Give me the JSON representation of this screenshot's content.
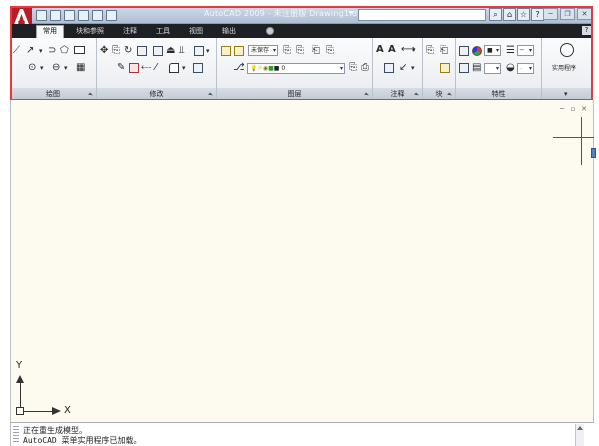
{
  "window": {
    "title": "AutoCAD 2009 - 未注册版 Drawing1.dwg",
    "quick_access_icons": [
      "new-icon",
      "open-icon",
      "save-icon",
      "plot-icon",
      "undo-icon",
      "redo-icon"
    ],
    "help_icons": [
      "search-icon",
      "infocenter-icon",
      "favorites-icon",
      "help-icon"
    ],
    "window_buttons": [
      "minimize",
      "restore",
      "close"
    ]
  },
  "tabs": [
    {
      "label": "常用",
      "active": true
    },
    {
      "label": "块和参照"
    },
    {
      "label": "注释"
    },
    {
      "label": "工具"
    },
    {
      "label": "视图"
    },
    {
      "label": "输出"
    }
  ],
  "ribbon": {
    "panels": [
      {
        "title": "绘图"
      },
      {
        "title": "修改"
      },
      {
        "title": "图层"
      },
      {
        "title": "注释"
      },
      {
        "title": "块"
      },
      {
        "title": "特性"
      },
      {
        "title": ""
      }
    ],
    "layer_state": "未保存",
    "layer_current": "0",
    "utilities_label": "实用程序"
  },
  "drawing": {
    "viewport_controls": [
      "─",
      "▫",
      "✕"
    ],
    "ucs_x": "X",
    "ucs_y": "Y"
  },
  "command_line": {
    "line1": "正在重生成模型。",
    "line2": "AutoCAD 菜单实用程序已加载。"
  },
  "colors": {
    "title_bar": "#aebfd4",
    "tab_bar": "#1f2023",
    "canvas": "#fdfbef",
    "highlight": "#e23a3f",
    "logo": "#c8202b"
  }
}
